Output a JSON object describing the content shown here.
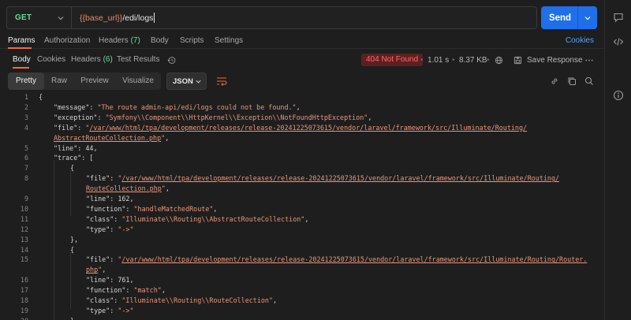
{
  "request": {
    "method": "GET",
    "url_variable": "{{base_url}}",
    "url_path": "/edi/logs",
    "send_label": "Send"
  },
  "request_tabs": [
    {
      "label": "Params",
      "active": true
    },
    {
      "label": "Authorization"
    },
    {
      "label": "Headers",
      "count": "(7)"
    },
    {
      "label": "Body"
    },
    {
      "label": "Scripts"
    },
    {
      "label": "Settings"
    }
  ],
  "cookies_label": "Cookies",
  "response_tabs": [
    {
      "label": "Body",
      "active": true
    },
    {
      "label": "Cookies"
    },
    {
      "label": "Headers",
      "count": "(6)"
    },
    {
      "label": "Test Results"
    }
  ],
  "response": {
    "status": "404 Not Found",
    "time": "1.01 s",
    "size": "8.37 KB",
    "save_label": "Save Response"
  },
  "view_modes": [
    "Pretty",
    "Raw",
    "Preview",
    "Visualize"
  ],
  "active_view": "Pretty",
  "format": "JSON",
  "icons": {
    "history": "history-icon",
    "globe": "globe-icon",
    "save": "save-icon",
    "wrap": "wrap-lines-icon",
    "link": "link-icon",
    "copy": "copy-icon",
    "search": "search-icon",
    "sidebar_top": "comment-icon",
    "sidebar_code": "code-icon",
    "sidebar_info": "info-icon"
  },
  "colors": {
    "accent": "#f26b3a",
    "send": "#1f6feb",
    "get": "#6bdd9a",
    "error_bg": "#5c2020",
    "error_text": "#ff6b6b",
    "string": "#e9967a"
  },
  "code_lines": [
    {
      "n": "1",
      "indent": 0,
      "parts": [
        {
          "t": "{",
          "c": "p"
        }
      ]
    },
    {
      "n": "2",
      "indent": 1,
      "parts": [
        {
          "t": "\"message\": ",
          "c": "key"
        },
        {
          "t": "\"The route admin-api/edi/logs could not be found.\"",
          "c": "str"
        },
        {
          "t": ",",
          "c": "p"
        }
      ]
    },
    {
      "n": "3",
      "indent": 1,
      "parts": [
        {
          "t": "\"exception\": ",
          "c": "key"
        },
        {
          "t": "\"Symfony\\\\Component\\\\HttpKernel\\\\Exception\\\\NotFoundHttpException\"",
          "c": "str"
        },
        {
          "t": ",",
          "c": "p"
        }
      ]
    },
    {
      "n": "4",
      "indent": 1,
      "parts": [
        {
          "t": "\"file\": ",
          "c": "key"
        },
        {
          "t": "\"",
          "c": "str"
        },
        {
          "t": "/var/www/html/tpa/development/releases/release-20241225073615/vendor/laravel/framework/src/Illuminate/Routing/",
          "c": "link"
        }
      ]
    },
    {
      "n": "",
      "indent": 1,
      "parts": [
        {
          "t": "AbstractRouteCollection.php",
          "c": "link"
        },
        {
          "t": "\"",
          "c": "str"
        },
        {
          "t": ",",
          "c": "p"
        }
      ]
    },
    {
      "n": "5",
      "indent": 1,
      "parts": [
        {
          "t": "\"line\": ",
          "c": "key"
        },
        {
          "t": "44",
          "c": "num"
        },
        {
          "t": ",",
          "c": "p"
        }
      ]
    },
    {
      "n": "6",
      "indent": 1,
      "parts": [
        {
          "t": "\"trace\": [",
          "c": "key"
        }
      ]
    },
    {
      "n": "7",
      "indent": 2,
      "parts": [
        {
          "t": "{",
          "c": "p"
        }
      ]
    },
    {
      "n": "8",
      "indent": 3,
      "parts": [
        {
          "t": "\"file\": ",
          "c": "key"
        },
        {
          "t": "\"",
          "c": "str"
        },
        {
          "t": "/var/www/html/tpa/development/releases/release-20241225073615/vendor/laravel/framework/src/Illuminate/Routing/",
          "c": "link"
        }
      ]
    },
    {
      "n": "",
      "indent": 3,
      "parts": [
        {
          "t": "RouteCollection.php",
          "c": "link"
        },
        {
          "t": "\"",
          "c": "str"
        },
        {
          "t": ",",
          "c": "p"
        }
      ]
    },
    {
      "n": "9",
      "indent": 3,
      "parts": [
        {
          "t": "\"line\": ",
          "c": "key"
        },
        {
          "t": "162",
          "c": "num"
        },
        {
          "t": ",",
          "c": "p"
        }
      ]
    },
    {
      "n": "10",
      "indent": 3,
      "parts": [
        {
          "t": "\"function\": ",
          "c": "key"
        },
        {
          "t": "\"handleMatchedRoute\"",
          "c": "str"
        },
        {
          "t": ",",
          "c": "p"
        }
      ]
    },
    {
      "n": "11",
      "indent": 3,
      "parts": [
        {
          "t": "\"class\": ",
          "c": "key"
        },
        {
          "t": "\"Illuminate\\\\Routing\\\\AbstractRouteCollection\"",
          "c": "str"
        },
        {
          "t": ",",
          "c": "p"
        }
      ]
    },
    {
      "n": "12",
      "indent": 3,
      "parts": [
        {
          "t": "\"type\": ",
          "c": "key"
        },
        {
          "t": "\"->\"",
          "c": "str"
        }
      ]
    },
    {
      "n": "13",
      "indent": 2,
      "parts": [
        {
          "t": "},",
          "c": "p"
        }
      ]
    },
    {
      "n": "14",
      "indent": 2,
      "parts": [
        {
          "t": "{",
          "c": "p"
        }
      ]
    },
    {
      "n": "15",
      "indent": 3,
      "parts": [
        {
          "t": "\"file\": ",
          "c": "key"
        },
        {
          "t": "\"",
          "c": "str"
        },
        {
          "t": "/var/www/html/tpa/development/releases/release-20241225073615/vendor/laravel/framework/src/Illuminate/Routing/Router.",
          "c": "link"
        }
      ]
    },
    {
      "n": "",
      "indent": 3,
      "parts": [
        {
          "t": "php",
          "c": "link"
        },
        {
          "t": "\"",
          "c": "str"
        },
        {
          "t": ",",
          "c": "p"
        }
      ]
    },
    {
      "n": "16",
      "indent": 3,
      "parts": [
        {
          "t": "\"line\": ",
          "c": "key"
        },
        {
          "t": "761",
          "c": "num"
        },
        {
          "t": ",",
          "c": "p"
        }
      ]
    },
    {
      "n": "17",
      "indent": 3,
      "parts": [
        {
          "t": "\"function\": ",
          "c": "key"
        },
        {
          "t": "\"match\"",
          "c": "str"
        },
        {
          "t": ",",
          "c": "p"
        }
      ]
    },
    {
      "n": "18",
      "indent": 3,
      "parts": [
        {
          "t": "\"class\": ",
          "c": "key"
        },
        {
          "t": "\"Illuminate\\\\Routing\\\\RouteCollection\"",
          "c": "str"
        },
        {
          "t": ",",
          "c": "p"
        }
      ]
    },
    {
      "n": "19",
      "indent": 3,
      "parts": [
        {
          "t": "\"type\": ",
          "c": "key"
        },
        {
          "t": "\"->\"",
          "c": "str"
        }
      ]
    },
    {
      "n": "20",
      "indent": 2,
      "parts": [
        {
          "t": "},",
          "c": "p"
        }
      ]
    }
  ]
}
